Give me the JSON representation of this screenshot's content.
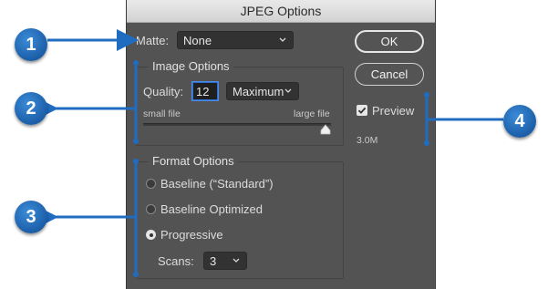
{
  "dialog": {
    "title": "JPEG Options",
    "matte": {
      "label": "Matte:",
      "value": "None"
    },
    "image_options": {
      "title": "Image Options",
      "quality_label": "Quality:",
      "quality_value": "12",
      "quality_preset": "Maximum",
      "small_file_label": "small file",
      "large_file_label": "large file",
      "slider_level": 1.0
    },
    "format_options": {
      "title": "Format Options",
      "radios": [
        {
          "label": "Baseline (“Standard”)",
          "selected": false
        },
        {
          "label": "Baseline Optimized",
          "selected": false
        },
        {
          "label": "Progressive",
          "selected": true
        }
      ],
      "scans_label": "Scans:",
      "scans_value": "3"
    },
    "buttons": {
      "ok": "OK",
      "cancel": "Cancel"
    },
    "preview": {
      "label": "Preview",
      "checked": true,
      "size": "3.0M"
    }
  },
  "callouts": [
    "1",
    "2",
    "3",
    "4"
  ],
  "colors": {
    "callout_blue": "#1f6cc0",
    "dialog_bg": "#535353",
    "focus_blue": "#2f6fd0"
  }
}
